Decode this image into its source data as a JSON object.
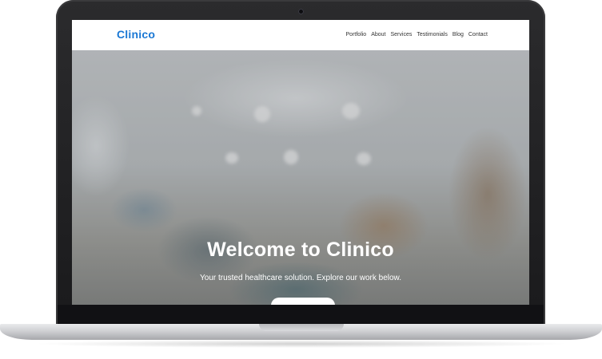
{
  "site": {
    "logo": "Clinico",
    "brand_color": "#1977d4",
    "nav": [
      {
        "label": "Portfolio"
      },
      {
        "label": "About"
      },
      {
        "label": "Services"
      },
      {
        "label": "Testimonials"
      },
      {
        "label": "Blog"
      },
      {
        "label": "Contact"
      }
    ]
  },
  "hero": {
    "title": "Welcome to Clinico",
    "subtitle": "Your trusted healthcare solution. Explore our work below.",
    "cta_label": ""
  },
  "icons": {
    "camera": "camera-icon"
  }
}
